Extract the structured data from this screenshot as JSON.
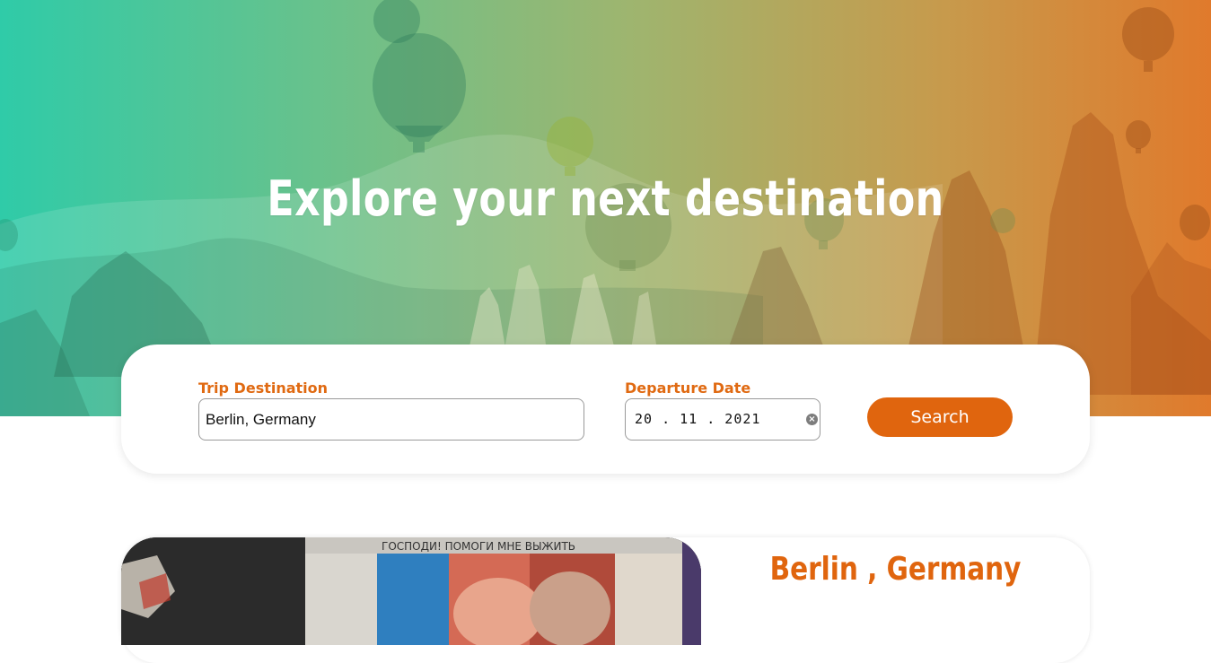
{
  "hero": {
    "title": "Explore your next destination"
  },
  "search": {
    "destination_label": "Trip Destination",
    "destination_value": "Berlin, Germany",
    "date_label": "Departure Date",
    "date_value": "20 . 11 . 2021",
    "search_button": "Search"
  },
  "result": {
    "title": "Berlin , Germany",
    "mural_caption": "ГОСПОДИ! ПОМОГИ МНЕ ВЫЖИТЬ"
  },
  "colors": {
    "accent": "#e0650e",
    "gradient_start": "#2fcba8",
    "gradient_end": "#e07a2c"
  },
  "icons": {
    "date_clear": "clear-circle-icon"
  }
}
